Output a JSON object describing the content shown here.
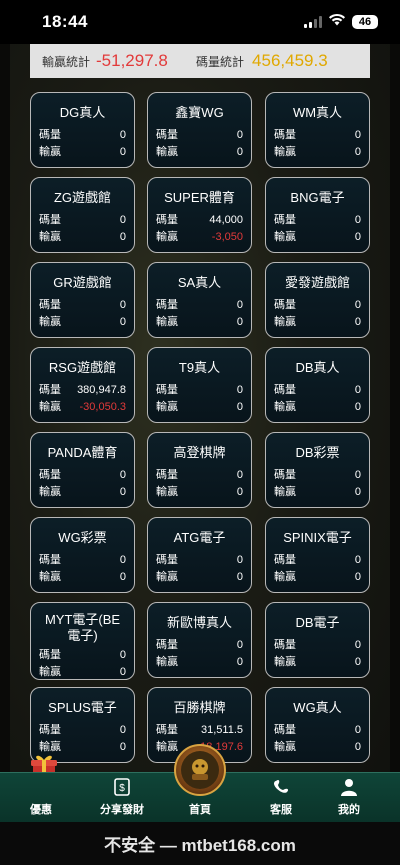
{
  "status": {
    "time": "18:44",
    "battery": "46"
  },
  "stats": {
    "win_loss_label": "輸贏統計",
    "win_loss_value": "-51,297.8",
    "bet_label": "碼量統計",
    "bet_value": "456,459.3"
  },
  "row_labels": {
    "bet": "碼量",
    "winloss": "輸贏"
  },
  "cards": [
    {
      "title": "DG真人",
      "bet": "0",
      "winloss": "0"
    },
    {
      "title": "鑫寶WG",
      "bet": "0",
      "winloss": "0"
    },
    {
      "title": "WM真人",
      "bet": "0",
      "winloss": "0"
    },
    {
      "title": "ZG遊戲館",
      "bet": "0",
      "winloss": "0"
    },
    {
      "title": "SUPER體育",
      "bet": "44,000",
      "winloss": "-3,050"
    },
    {
      "title": "BNG電子",
      "bet": "0",
      "winloss": "0"
    },
    {
      "title": "GR遊戲館",
      "bet": "0",
      "winloss": "0"
    },
    {
      "title": "SA真人",
      "bet": "0",
      "winloss": "0"
    },
    {
      "title": "愛發遊戲館",
      "bet": "0",
      "winloss": "0"
    },
    {
      "title": "RSG遊戲館",
      "bet": "380,947.8",
      "winloss": "-30,050.3"
    },
    {
      "title": "T9真人",
      "bet": "0",
      "winloss": "0"
    },
    {
      "title": "DB真人",
      "bet": "0",
      "winloss": "0"
    },
    {
      "title": "PANDA體育",
      "bet": "0",
      "winloss": "0"
    },
    {
      "title": "高登棋牌",
      "bet": "0",
      "winloss": "0"
    },
    {
      "title": "DB彩票",
      "bet": "0",
      "winloss": "0"
    },
    {
      "title": "WG彩票",
      "bet": "0",
      "winloss": "0"
    },
    {
      "title": "ATG電子",
      "bet": "0",
      "winloss": "0"
    },
    {
      "title": "SPINIX電子",
      "bet": "0",
      "winloss": "0"
    },
    {
      "title": "MYT電子(BE電子)",
      "bet": "0",
      "winloss": "0"
    },
    {
      "title": "新歐博真人",
      "bet": "0",
      "winloss": "0"
    },
    {
      "title": "DB電子",
      "bet": "0",
      "winloss": "0"
    },
    {
      "title": "SPLUS電子",
      "bet": "0",
      "winloss": "0"
    },
    {
      "title": "百勝棋牌",
      "bet": "31,511.5",
      "winloss": "-18,197.6"
    },
    {
      "title": "WG真人",
      "bet": "0",
      "winloss": "0"
    }
  ],
  "tabs": {
    "promo": "優惠",
    "share": "分享發財",
    "home": "首頁",
    "service": "客服",
    "mine": "我的"
  },
  "url": "不安全 — mtbet168.com",
  "colors": {
    "negative": "#e23a3a",
    "bet_total": "#e0a800",
    "tab_bar": "#0f4538"
  }
}
